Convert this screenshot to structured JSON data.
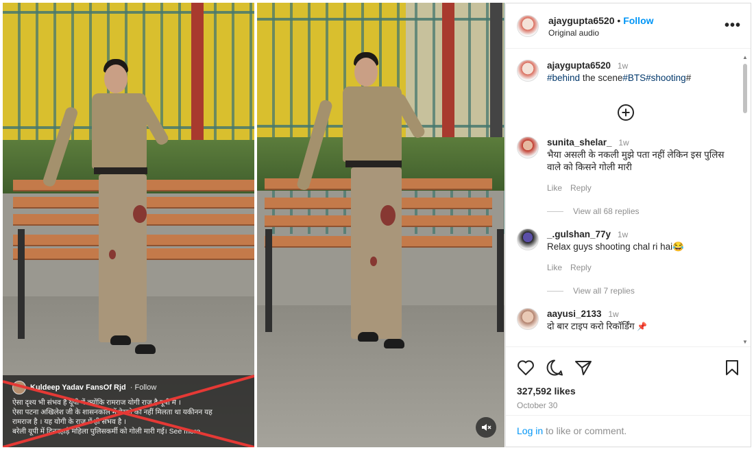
{
  "facebook_post": {
    "author": "Kuldeep Yadav FansOf Rjd",
    "follow_label": "· Follow",
    "text_line_1": "ऐसा दृश्य भी संभव है यूपी में क्योंकि रामराज योगी राज है यूपी में ।",
    "text_line_2": "ऐसा पटना अखिलेश जी के शासनकाल में देखने को नहीं मिलता था यकीनन यह",
    "text_line_3": "रामराज है । यह योगी के राज में ही संभव है ।",
    "text_line_4": "बरेली यूपी में दिनदहाड़े महिला पुलिसकर्मी को गोली मारी गई।",
    "see_more": "See more",
    "cross_color": "#e53935"
  },
  "video": {
    "mute_icon": "speaker-muted-icon"
  },
  "instagram": {
    "header": {
      "username": "ajaygupta6520",
      "separator": "•",
      "follow": "Follow",
      "audio": "Original audio",
      "more_icon": "•••"
    },
    "caption": {
      "username": "ajaygupta6520",
      "time": "1w",
      "tag_1": "#behind",
      "text_1": " the scene",
      "tag_2": "#BTS",
      "tag_3": "#shooting",
      "tag_4": "#"
    },
    "load_more_icon": "plus-circle-icon",
    "comments": [
      {
        "username": "sunita_shelar_",
        "time": "1w",
        "text": "भैया असली के नकली मुझे पता नहीं लेकिन इस पुलिस वाले को किसने गोली मारी",
        "like": "Like",
        "reply": "Reply",
        "view_replies": "View all 68 replies"
      },
      {
        "username": "_.gulshan_77y",
        "time": "1w",
        "text": "Relax guys shooting chal ri hai😂",
        "like": "Like",
        "reply": "Reply",
        "view_replies": "View all 7 replies"
      },
      {
        "username": "aayusi_2133",
        "time": "1w",
        "text": "दो बार टाइप करो रिकॉर्डिंग",
        "pin": "📌"
      }
    ],
    "likes": "327,592 likes",
    "date": "October 30",
    "login_link": "Log in",
    "login_text": " to like or comment."
  }
}
